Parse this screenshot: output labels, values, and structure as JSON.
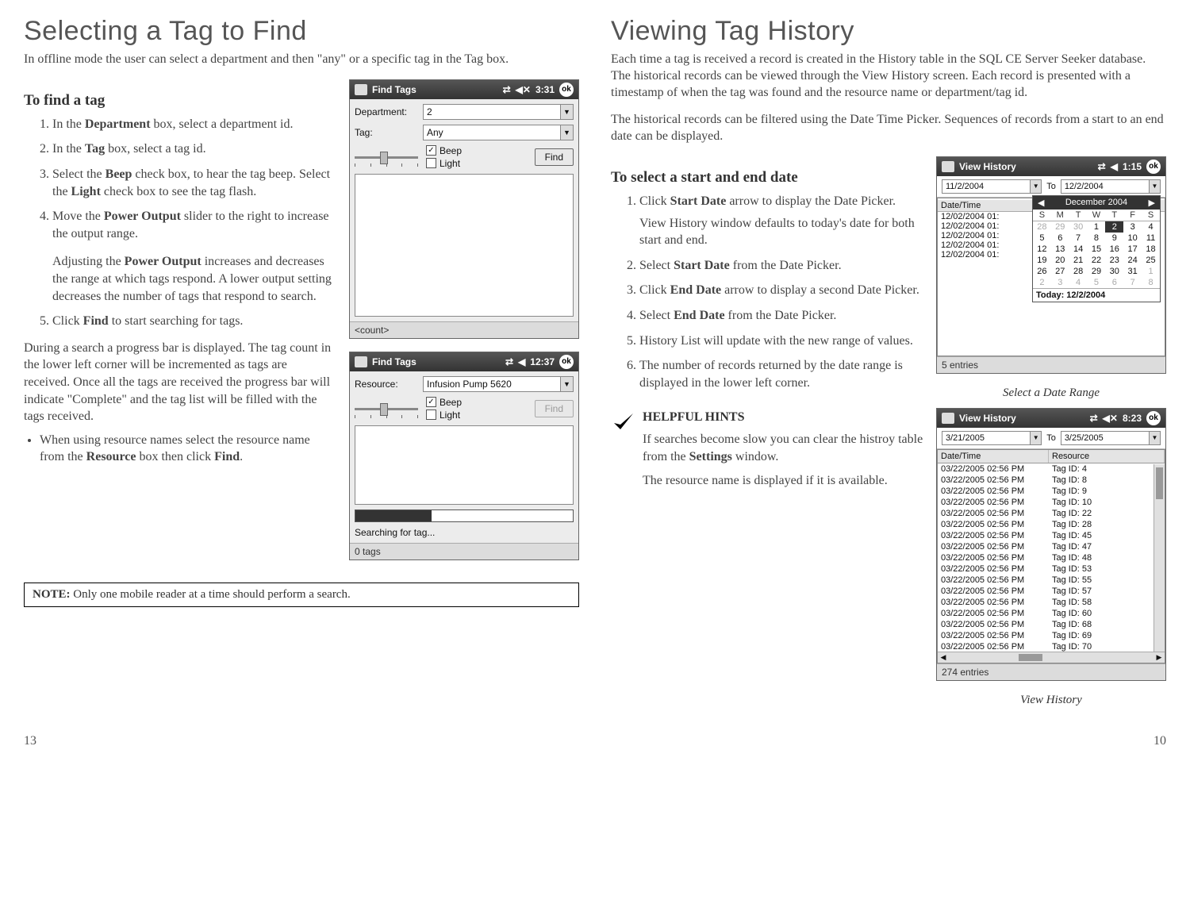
{
  "left": {
    "title": "Selecting a Tag to Find",
    "intro": "In offline mode the user can select a department and then \"any\" or a specific tag in the Tag box.",
    "to_find_heading": "To find a tag",
    "steps": {
      "s1a": "In the ",
      "s1b": "Department",
      "s1c": " box, select a department id.",
      "s2a": "In the ",
      "s2b": "Tag",
      "s2c": " box, select a tag id.",
      "s3a": "Select the ",
      "s3b": "Beep",
      "s3c": " check box, to hear the tag beep.  Select the ",
      "s3d": "Light",
      "s3e": " check box to see the tag flash.",
      "s4a": "Move the ",
      "s4b": "Power Output",
      "s4c": " slider to the right to increase the output range.",
      "s4_extra_a": "Adjusting the ",
      "s4_extra_b": "Power Output",
      "s4_extra_c": " increases and decreases the range at which tags respond.  A lower output setting decreases the number of tags that respond to search.",
      "s5a": "Click ",
      "s5b": "Find",
      "s5c": " to start searching for tags."
    },
    "during_para": "During a search a progress bar is displayed.  The tag count in the lower left corner will be incremented as tags are received.  Once all the tags are received the progress bar will indicate \"Complete\" and the tag list will be filled with the tags received.",
    "bullet_a": "When using resource names select the resource name from the ",
    "bullet_b": "Resource",
    "bullet_c": " box then click ",
    "bullet_d": "Find",
    "bullet_e": ".",
    "note_label": "NOTE:",
    "note_text": " Only one mobile reader at a time should perform a search.",
    "shot1": {
      "title": "Find Tags",
      "time": "3:31",
      "ok": "ok",
      "dept_label": "Department:",
      "dept_value": "2",
      "tag_label": "Tag:",
      "tag_value": "Any",
      "beep": "Beep",
      "light": "Light",
      "find_btn": "Find",
      "status": "<count>"
    },
    "shot2": {
      "title": "Find Tags",
      "time": "12:37",
      "ok": "ok",
      "res_label": "Resource:",
      "res_value": "Infusion Pump 5620",
      "beep": "Beep",
      "light": "Light",
      "find_btn": "Find",
      "searching": "Searching for tag...",
      "status": "0 tags"
    },
    "page_num": "13"
  },
  "right": {
    "title": "Viewing Tag History",
    "intro1": "Each time a tag is received a record is created in the History table in the SQL CE Server Seeker database.  The historical records can be viewed through the View History screen.  Each record is presented with a timestamp of when the tag was found and the resource name or department/tag id.",
    "intro2": "The historical records can be filtered using the Date Time Picker.  Sequences of records from a start to an end date can be displayed.",
    "select_heading": "To select a start and end date",
    "steps": {
      "s1a": "Click ",
      "s1b": "Start Date",
      "s1c": " arrow to display the Date Picker.",
      "s1_extra": "View History window defaults to today's date for both start and end.",
      "s2a": "Select ",
      "s2b": "Start Date",
      "s2c": " from the Date Picker.",
      "s3a": "Click ",
      "s3b": "End Date",
      "s3c": " arrow to display a second Date Picker.",
      "s4a": "Select ",
      "s4b": "End Date",
      "s4c": " from the Date Picker.",
      "s5": "History List will update with the new range of values.",
      "s6": "The number of records returned by the date range is displayed in the lower left corner."
    },
    "hint_title": "HELPFUL HINTS",
    "hint_p1a": "If searches become slow you can clear the histroy table  from the ",
    "hint_p1b": "Settings",
    "hint_p1c": " window.",
    "hint_p2": "The resource name is  displayed if it is available.",
    "shot1": {
      "title": "View History",
      "time": "1:15",
      "ok": "ok",
      "start": "11/2/2004",
      "to": "To",
      "end": "12/2/2004",
      "dt_head": "Date/Time",
      "cal_month": "December 2004",
      "cal_days": [
        "S",
        "M",
        "T",
        "W",
        "T",
        "F",
        "S"
      ],
      "today": "Today: 12/2/2004",
      "status": "5 entries",
      "rows": [
        "12/02/2004 01:",
        "12/02/2004 01:",
        "12/02/2004 01:",
        "12/02/2004 01:",
        "12/02/2004 01:"
      ]
    },
    "caption1": "Select a Date Range",
    "shot2": {
      "title": "View History",
      "time": "8:23",
      "ok": "ok",
      "start": "3/21/2005",
      "to": "To",
      "end": "3/25/2005",
      "col1": "Date/Time",
      "col2": "Resource",
      "rows": [
        {
          "dt": "03/22/2005 02:56 PM",
          "res": "Tag ID: 4"
        },
        {
          "dt": "03/22/2005 02:56 PM",
          "res": "Tag ID: 8"
        },
        {
          "dt": "03/22/2005 02:56 PM",
          "res": "Tag ID: 9"
        },
        {
          "dt": "03/22/2005 02:56 PM",
          "res": "Tag ID: 10"
        },
        {
          "dt": "03/22/2005 02:56 PM",
          "res": "Tag ID: 22"
        },
        {
          "dt": "03/22/2005 02:56 PM",
          "res": "Tag ID: 28"
        },
        {
          "dt": "03/22/2005 02:56 PM",
          "res": "Tag ID: 45"
        },
        {
          "dt": "03/22/2005 02:56 PM",
          "res": "Tag ID: 47"
        },
        {
          "dt": "03/22/2005 02:56 PM",
          "res": "Tag ID: 48"
        },
        {
          "dt": "03/22/2005 02:56 PM",
          "res": "Tag ID: 53"
        },
        {
          "dt": "03/22/2005 02:56 PM",
          "res": "Tag ID: 55"
        },
        {
          "dt": "03/22/2005 02:56 PM",
          "res": "Tag ID: 57"
        },
        {
          "dt": "03/22/2005 02:56 PM",
          "res": "Tag ID: 58"
        },
        {
          "dt": "03/22/2005 02:56 PM",
          "res": "Tag ID: 60"
        },
        {
          "dt": "03/22/2005 02:56 PM",
          "res": "Tag ID: 68"
        },
        {
          "dt": "03/22/2005 02:56 PM",
          "res": "Tag ID: 69"
        },
        {
          "dt": "03/22/2005 02:56 PM",
          "res": "Tag ID: 70"
        }
      ],
      "status": "274 entries"
    },
    "caption2": "View History",
    "page_num": "10"
  }
}
